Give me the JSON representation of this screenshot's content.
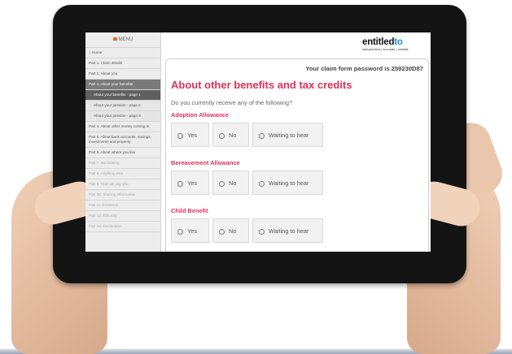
{
  "sidebar": {
    "menu_label": "MENU",
    "items": [
      {
        "label": "Home"
      },
      {
        "label": "Part 1. Claim details"
      },
      {
        "label": "Part 2. About you"
      },
      {
        "label": "Part 3. About your benefits"
      },
      {
        "label": "About your benefits - page 1"
      },
      {
        "label": "About your pension - page 2"
      },
      {
        "label": "About your pension - page 3"
      },
      {
        "label": "Part 4. About other money coming in"
      },
      {
        "label": "Part 5. About bank accounts, savings, investments and property"
      },
      {
        "label": "Part 6. About where you live"
      },
      {
        "label": "Part 7. Backdating"
      },
      {
        "label": "Part 8. Anything else"
      },
      {
        "label": "Part 9. How we pay you"
      },
      {
        "label": "Part 10. Sharing information"
      },
      {
        "label": "Part 11. Evidence"
      },
      {
        "label": "Part 12. Ethnicity"
      },
      {
        "label": "Part 13. Declaration"
      }
    ]
  },
  "brand": {
    "name_a": "entitled",
    "name_b": "to",
    "tagline": "independent | accurate | reliable"
  },
  "main": {
    "password_text": "Your claim form password is 259230D87",
    "title": "About other benefits and tax credits",
    "question": "Do you currently receive any of the following?",
    "option_labels": {
      "yes": "Yes",
      "no": "No",
      "waiting": "Waiting to hear"
    },
    "sections": [
      {
        "title": "Adoption Allowance"
      },
      {
        "title": "Bereavement Allowance"
      },
      {
        "title": "Child Benefit"
      }
    ]
  },
  "colors": {
    "accent": "#e0305a",
    "brand_blue": "#1d8fd1",
    "sidebar_active": "#5f5f5f"
  }
}
